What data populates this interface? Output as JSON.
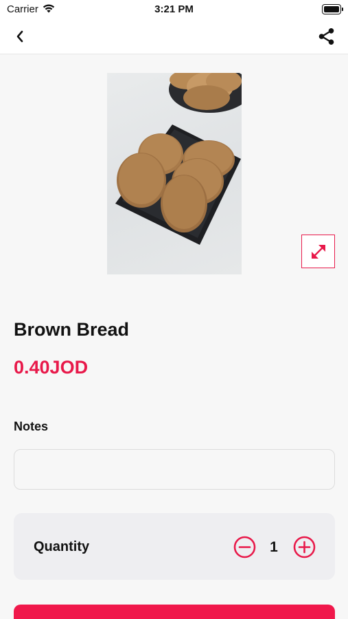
{
  "status_bar": {
    "carrier": "Carrier",
    "time": "3:21 PM"
  },
  "nav": {
    "back_icon": "chevron-left-icon",
    "share_icon": "share-icon"
  },
  "product": {
    "image_description_icon": "product-photo",
    "expand_icon": "expand-arrows-icon",
    "name": "Brown Bread",
    "price": "0.40JOD"
  },
  "notes": {
    "label": "Notes",
    "value": "",
    "placeholder": ""
  },
  "quantity": {
    "label": "Quantity",
    "value": "1",
    "minus_icon": "minus-circle-icon",
    "plus_icon": "plus-circle-icon"
  },
  "colors": {
    "accent": "#e8194a",
    "background": "#f7f7f7",
    "card": "#eeeef1"
  }
}
